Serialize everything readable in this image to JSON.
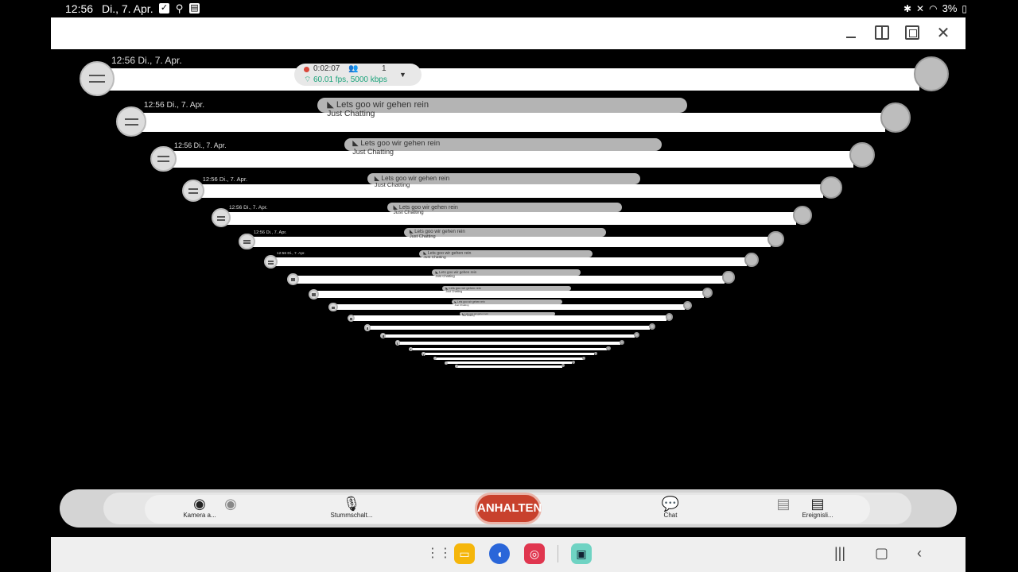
{
  "status_bar": {
    "time": "12:56",
    "date": "Di., 7. Apr.",
    "battery": "3%"
  },
  "stream_overlay": {
    "duration": "0:02:07",
    "viewers": "1",
    "stats": "60.01 fps, 5000 kbps"
  },
  "stream_info": {
    "title": "Lets goo wir gehen rein",
    "category": "Just Chatting"
  },
  "controls": {
    "camera_label": "Kamera a...",
    "mic_label": "Stummschalt...",
    "stop_label": "ANHALTEN",
    "chat_label": "Chat",
    "events_label": "Ereignisli..."
  },
  "colors": {
    "stop_button": "#c8412d",
    "stats_text": "#1aa37a",
    "recording_dot": "#d9473a"
  },
  "icons": {
    "status": [
      "check-icon",
      "search-icon",
      "clipboard-icon"
    ],
    "status_right": [
      "bluetooth-icon",
      "mute-icon",
      "wifi-icon",
      "battery-icon"
    ],
    "taskbar": [
      "apps-grid-icon",
      "files-icon",
      "messages-icon",
      "camera-icon",
      "streaming-app-icon"
    ],
    "nav": [
      "recents-icon",
      "home-icon",
      "back-icon"
    ]
  }
}
